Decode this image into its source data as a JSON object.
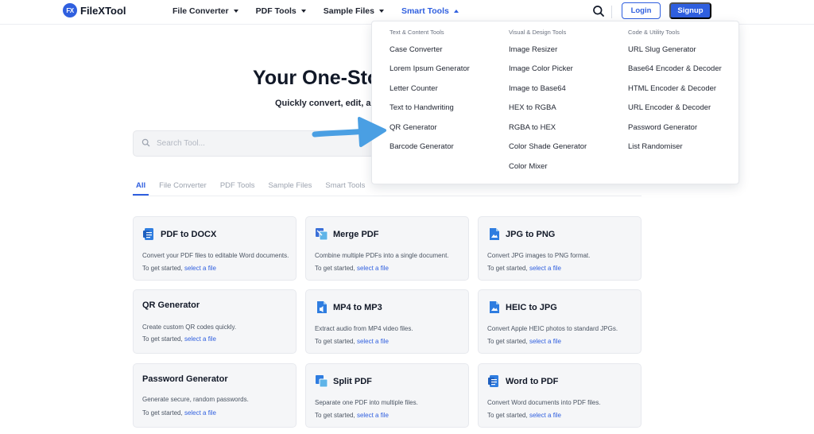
{
  "brand": {
    "logo_mark": "FX",
    "name": "FileXTool",
    "color": "#2f5fdf"
  },
  "nav": {
    "items": [
      {
        "label": "File Converter",
        "icon": "chevron-down-icon"
      },
      {
        "label": "PDF Tools",
        "icon": "chevron-down-icon"
      },
      {
        "label": "Sample Files",
        "icon": "chevron-down-icon"
      },
      {
        "label": "Smart Tools",
        "icon": "chevron-up-icon",
        "active": true
      }
    ],
    "search_icon": "search-icon",
    "login_label": "Login",
    "signup_label": "Signup"
  },
  "hero": {
    "title": "Your One-Sto",
    "subtitle": "Quickly convert, edit, an",
    "search_placeholder": "Search Tool..."
  },
  "tabs": [
    "All",
    "File Converter",
    "PDF Tools",
    "Sample Files",
    "Smart Tools"
  ],
  "cards": [
    {
      "title": "PDF to DOCX",
      "desc": "Convert your PDF files to editable Word documents.",
      "cta_prefix": "To get started,",
      "cta_link": "select a file",
      "icon": "word-doc-icon"
    },
    {
      "title": "Merge PDF",
      "desc": "Combine multiple PDFs into a single document.",
      "cta_prefix": "To get started,",
      "cta_link": "select a file",
      "icon": "merge-pdf-icon"
    },
    {
      "title": "JPG to PNG",
      "desc": "Convert JPG images to PNG format.",
      "cta_prefix": "To get started,",
      "cta_link": "select a file",
      "icon": "image-file-icon"
    },
    {
      "title": "QR Generator",
      "desc": "Create custom QR codes quickly.",
      "cta_prefix": "To get started,",
      "cta_link": "select a file",
      "icon": ""
    },
    {
      "title": "MP4 to MP3",
      "desc": "Extract audio from MP4 video files.",
      "cta_prefix": "To get started,",
      "cta_link": "select a file",
      "icon": "audio-file-icon"
    },
    {
      "title": "HEIC to JPG",
      "desc": "Convert Apple HEIC photos to standard JPGs.",
      "cta_prefix": "To get started,",
      "cta_link": "select a file",
      "icon": "image-file-icon"
    },
    {
      "title": "Password Generator",
      "desc": "Generate secure, random passwords.",
      "cta_prefix": "To get started,",
      "cta_link": "select a file",
      "icon": ""
    },
    {
      "title": "Split PDF",
      "desc": "Separate one PDF into multiple files.",
      "cta_prefix": "To get started,",
      "cta_link": "select a file",
      "icon": "split-pdf-icon"
    },
    {
      "title": "Word to PDF",
      "desc": "Convert Word documents into PDF files.",
      "cta_prefix": "To get started,",
      "cta_link": "select a file",
      "icon": "word-doc-icon"
    }
  ],
  "smart_tools_menu": {
    "columns": [
      {
        "heading": "Text & Content Tools",
        "items": [
          "Case Converter",
          "Lorem Ipsum Generator",
          "Letter Counter",
          "Text to Handwriting",
          "QR Generator",
          "Barcode Generator"
        ]
      },
      {
        "heading": "Visual & Design Tools",
        "items": [
          "Image Resizer",
          "Image Color Picker",
          "Image to Base64",
          "HEX to RGBA",
          "RGBA to HEX",
          "Color Shade Generator",
          "Color Mixer"
        ]
      },
      {
        "heading": "Code & Utility Tools",
        "items": [
          "URL Slug Generator",
          "Base64 Encoder & Decoder",
          "HTML Encoder & Decoder",
          "URL Encoder & Decoder",
          "Password Generator",
          "List Randomiser"
        ]
      }
    ]
  },
  "annotation": {
    "icon": "pointer-arrow-icon",
    "color": "#4a9fe3"
  }
}
